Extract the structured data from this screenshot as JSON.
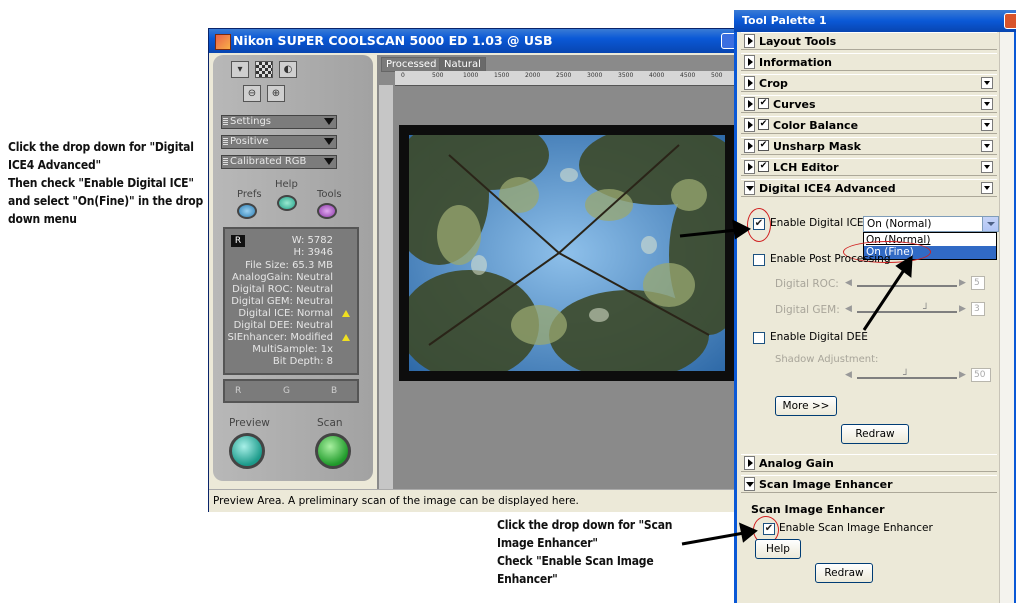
{
  "notes": {
    "left": [
      "Click the drop down for \"Digital",
      "ICE4 Advanced\"",
      "Then check \"Enable Digital ICE\"",
      "and select \"On(Fine)\" in the drop",
      "down menu"
    ],
    "bottom": [
      "Click the drop down for \"Scan",
      "Image Enhancer\"",
      "Check \"Enable Scan Image",
      "Enhancer\""
    ]
  },
  "scanner": {
    "title": "Nikon SUPER COOLSCAN 5000 ED 1.03 @ USB",
    "tabs": [
      "Processed",
      "Natural"
    ],
    "ruler_ticks": [
      "0",
      "500",
      "1000",
      "1500",
      "2000",
      "2500",
      "3000",
      "3500",
      "4000",
      "4500",
      "500"
    ],
    "dropdowns": [
      "Settings",
      "Positive",
      "Calibrated RGB"
    ],
    "prefs_label": "Prefs",
    "help_label": "Help",
    "tools_label": "Tools",
    "info": {
      "width": "W: 5782",
      "height": "H: 3946",
      "file_size": "File Size: 65.3 MB",
      "analog_gain": "AnalogGain: Neutral",
      "digital_roc": "Digital ROC: Neutral",
      "digital_gem": "Digital GEM: Neutral",
      "digital_ice": "Digital ICE: Normal",
      "digital_dee": "Digital DEE: Neutral",
      "si_enhancer": "SIEnhancer: Modified",
      "multisample": "MultiSample: 1x",
      "bit_depth": "Bit Depth: 8"
    },
    "rgb": [
      "R",
      "G",
      "B"
    ],
    "preview_label": "Preview",
    "scan_label": "Scan",
    "status": "Preview Area. A preliminary scan of the image can be displayed here."
  },
  "palette": {
    "title": "Tool Palette 1",
    "sections": {
      "layout": "Layout Tools",
      "information": "Information",
      "crop": "Crop",
      "curves": "Curves",
      "color_balance": "Color Balance",
      "unsharp": "Unsharp Mask",
      "lch": "LCH Editor",
      "ice": "Digital ICE4 Advanced",
      "analog": "Analog Gain",
      "sie": "Scan Image Enhancer"
    },
    "ice": {
      "enable_ice": "Enable Digital ICE",
      "ice_value": "On (Normal)",
      "options": [
        "On (Normal)",
        "On (Fine)"
      ],
      "enable_post": "Enable Post Processing",
      "roc_label": "Digital ROC:",
      "roc_value": "5",
      "gem_label": "Digital GEM:",
      "gem_value": "3",
      "enable_dee": "Enable Digital DEE",
      "shadow_label": "Shadow Adjustment:",
      "shadow_value": "50",
      "more": "More >>",
      "redraw": "Redraw"
    },
    "sie": {
      "heading": "Scan Image Enhancer",
      "enable": "Enable Scan Image Enhancer",
      "help": "Help",
      "redraw": "Redraw"
    }
  }
}
